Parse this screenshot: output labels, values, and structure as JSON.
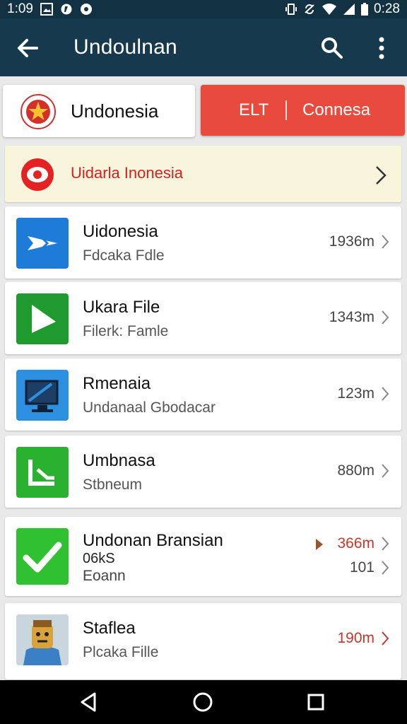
{
  "status_bar": {
    "time_left": "1:09",
    "time_right": "0:28",
    "icons_left": [
      "image-icon",
      "whatsapp-icon",
      "circle-app-icon"
    ],
    "icons_right": [
      "vibrate-icon",
      "sync-off-icon",
      "wifi-icon",
      "signal-icon",
      "battery-icon"
    ]
  },
  "app_bar": {
    "title": "Undoulnan",
    "back_icon": "arrow-left-icon",
    "search_icon": "search-icon",
    "more_icon": "more-vert-icon",
    "color": "#17394d"
  },
  "language_card": {
    "label": "Undonesia"
  },
  "action_button": {
    "left_label": "ELT",
    "right_label": "Connesa",
    "color": "#e84a3d"
  },
  "banner": {
    "text": "Uidarla Inonesia",
    "text_color": "#d62020",
    "background": "#f8f5dc"
  },
  "list": {
    "items": [
      {
        "title": "Uidonesia",
        "subtitle": "Fdcaka Fdle",
        "size": "1936m",
        "icon": "send-arrow-icon",
        "icon_color": "#1e7bd8"
      },
      {
        "title": "Ukara File",
        "subtitle": "Filerk: Famle",
        "size": "1343m",
        "icon": "play-icon",
        "icon_color": "#1f9a2e"
      },
      {
        "title": "Rmenaia",
        "subtitle": "Undanaal Gbodacar",
        "size": "123m",
        "icon": "monitor-icon",
        "icon_color": "#2d8fe0"
      },
      {
        "title": "Umbnasa",
        "subtitle": "Stbneum",
        "size": "880m",
        "icon": "chart-corner-icon",
        "icon_color": "#29b12f"
      },
      {
        "title": "Undonan Bransian",
        "subtitle": "06kS",
        "subtitle2": "Eoann",
        "size": "366m",
        "size2": "101",
        "icon": "checkmark-icon",
        "icon_color": "#2fc12f"
      },
      {
        "title": "Staflea",
        "subtitle": "Plcaka Fille",
        "size": "190m",
        "icon": "character-avatar-icon",
        "icon_color": "#d9a23a"
      }
    ]
  },
  "nav_bar": {
    "back": "nav-back-icon",
    "home": "nav-home-icon",
    "recents": "nav-recents-icon"
  }
}
